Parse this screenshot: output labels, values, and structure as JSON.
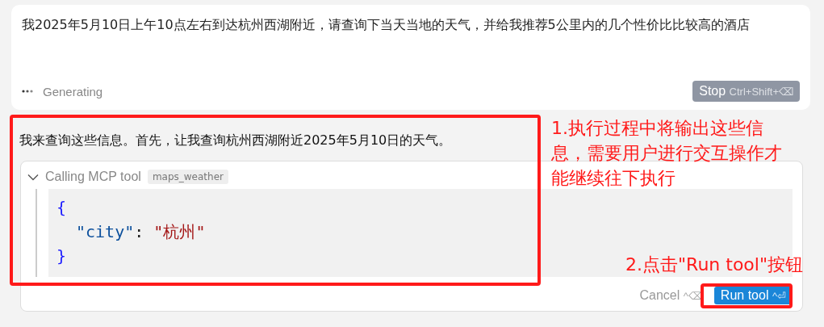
{
  "prompt": {
    "text": "我2025年5月10日上午10点左右到达杭州西湖附近，请查询下当天当地的天气，并给我推荐5公里内的几个性价比比较高的酒店",
    "status": "Generating",
    "stop_label": "Stop",
    "stop_shortcut": "Ctrl+Shift+⌫"
  },
  "response": {
    "text": "我来查询这些信息。首先，让我查询杭州西湖附近2025年5月10日的天气。"
  },
  "tool_call": {
    "expanded": true,
    "title": "Calling MCP tool",
    "tool_name": "maps_weather",
    "code_lines": [
      [
        {
          "kind": "brace",
          "text": "{"
        }
      ],
      [
        {
          "kind": "key",
          "text": "\"city\""
        },
        {
          "kind": "punct",
          "text": ": "
        },
        {
          "kind": "string",
          "text": "\"杭州\""
        }
      ],
      [
        {
          "kind": "brace",
          "text": "}"
        }
      ]
    ],
    "cancel_label": "Cancel",
    "cancel_shortcut": "^⌫",
    "run_label": "Run tool",
    "run_shortcut": "^⏎"
  },
  "annotations": [
    {
      "kind": "note",
      "text": "1.执行过程中将输出这些信息，需要用户进行交互操作才能继续往下执行"
    },
    {
      "kind": "step",
      "text": "2.点击\"Run tool\"按钮"
    }
  ]
}
